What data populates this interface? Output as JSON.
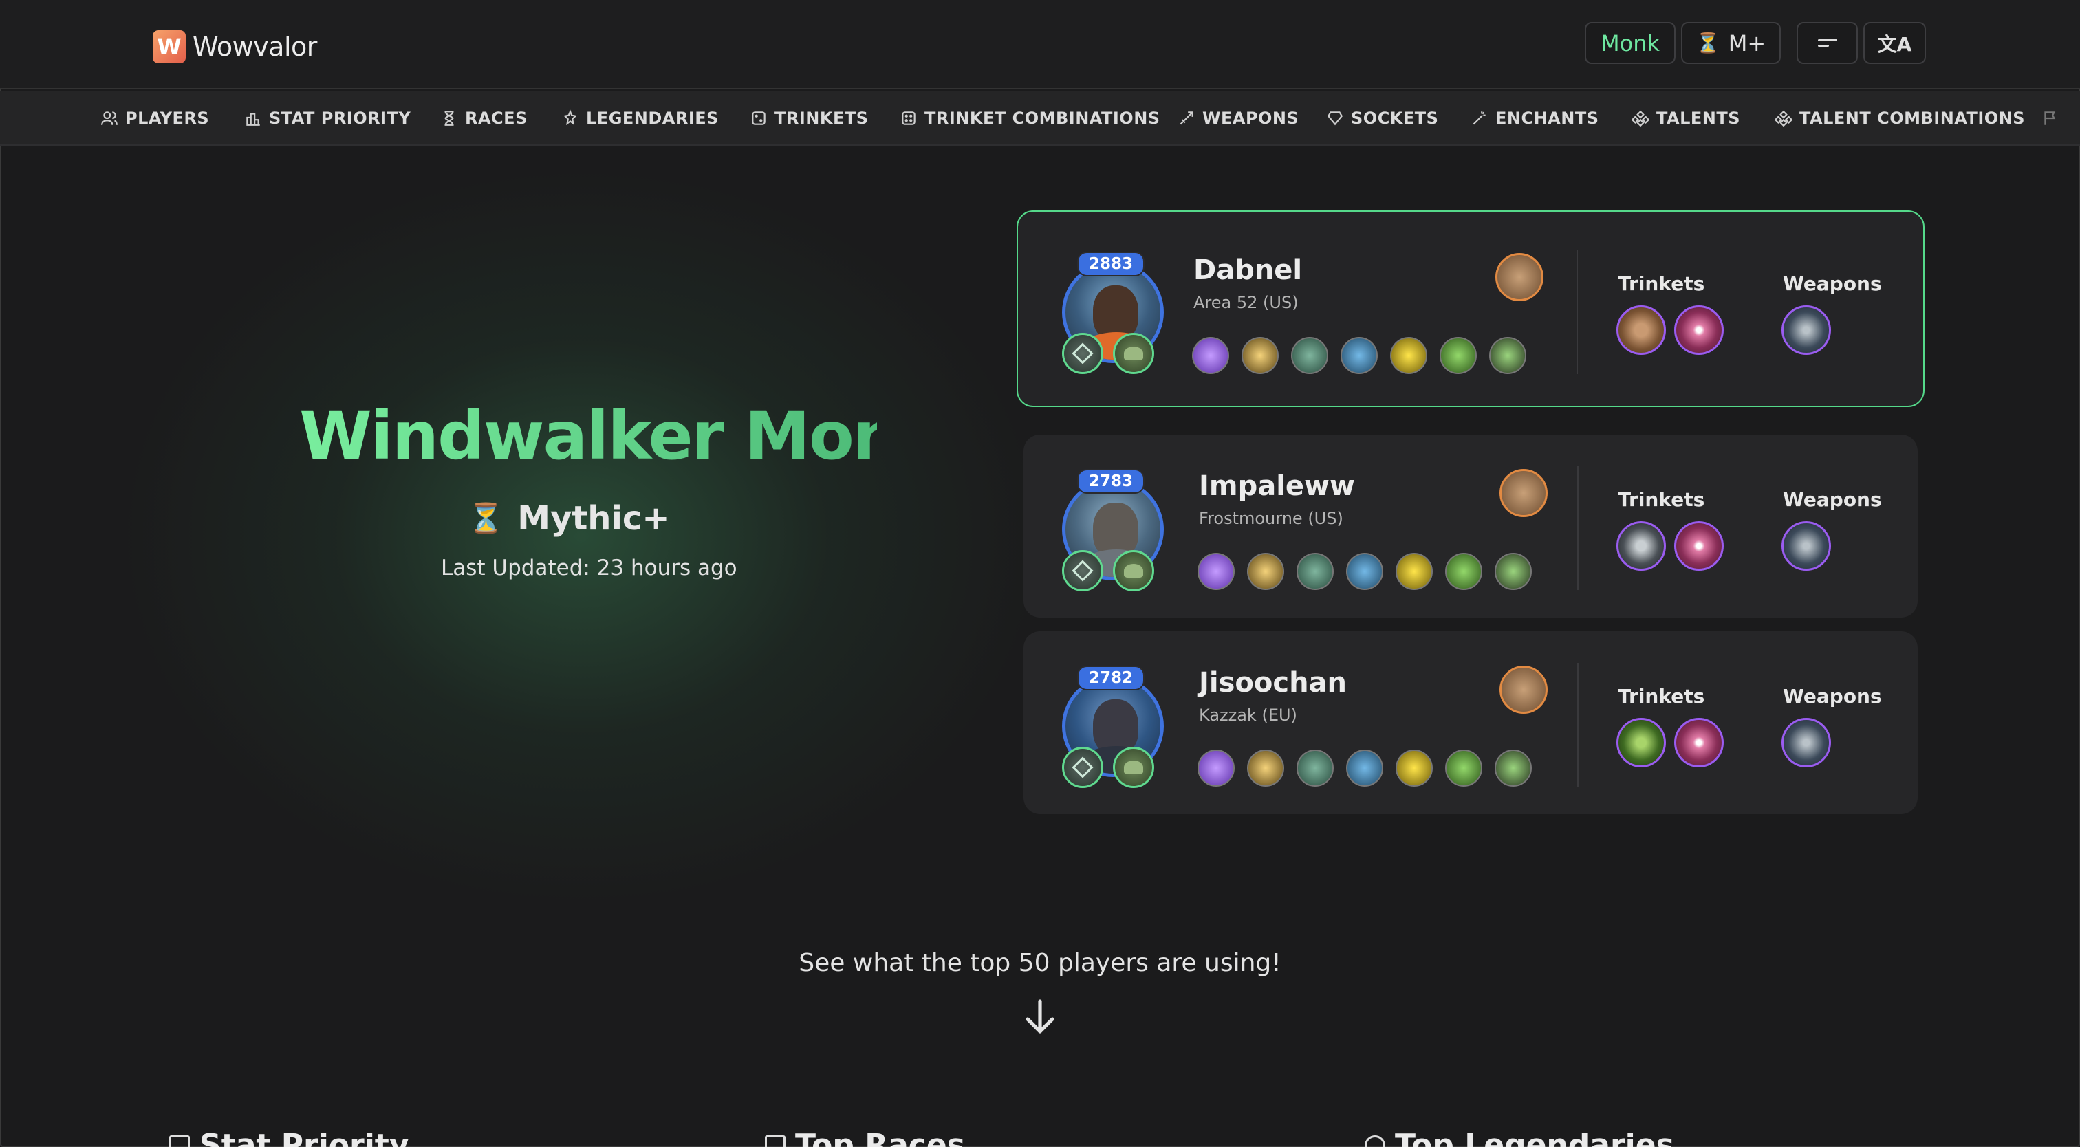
{
  "header": {
    "brand": "Wowvalor",
    "brand_initial": "W",
    "class_button": "Monk",
    "mode_button": "M+",
    "hourglass_glyph": "⏳",
    "lang_glyph": "文A"
  },
  "nav": {
    "items": [
      {
        "label": "PLAYERS",
        "icon": "users-icon"
      },
      {
        "label": "STAT PRIORITY",
        "icon": "bar-chart-icon"
      },
      {
        "label": "RACES",
        "icon": "hourglass-icon"
      },
      {
        "label": "LEGENDARIES",
        "icon": "legendary-icon"
      },
      {
        "label": "TRINKETS",
        "icon": "dice-icon"
      },
      {
        "label": "TRINKET COMBINATIONS",
        "icon": "dice-icon"
      },
      {
        "label": "WEAPONS",
        "icon": "sword-icon"
      },
      {
        "label": "SOCKETS",
        "icon": "gem-icon"
      },
      {
        "label": "ENCHANTS",
        "icon": "wand-icon"
      },
      {
        "label": "TALENTS",
        "icon": "talent-icon"
      },
      {
        "label": "TALENT COMBINATIONS",
        "icon": "talent-icon"
      }
    ]
  },
  "hero": {
    "title": "Windwalker Monk",
    "mode": "Mythic+",
    "updated": "Last Updated: 23 hours ago"
  },
  "players": [
    {
      "rating": "2883",
      "name": "Dabnel",
      "realm": "Area 52 (US)",
      "trinkets_label": "Trinkets",
      "weapons_label": "Weapons"
    },
    {
      "rating": "2783",
      "name": "Impaleww",
      "realm": "Frostmourne (US)",
      "trinkets_label": "Trinkets",
      "weapons_label": "Weapons"
    },
    {
      "rating": "2782",
      "name": "Jisoochan",
      "realm": "Kazzak (EU)",
      "trinkets_label": "Trinkets",
      "weapons_label": "Weapons"
    }
  ],
  "cta": "See what the top 50 players are using!",
  "sections": {
    "stat_priority": "Stat Priority",
    "top_races": "Top Races",
    "top_legendaries": "Top Legendaries"
  },
  "colors": {
    "accent_green": "#5fd98f",
    "rating_blue": "#3a6fe0",
    "epic_purple": "#9a5cf0",
    "legendary_orange": "#e28a42"
  }
}
